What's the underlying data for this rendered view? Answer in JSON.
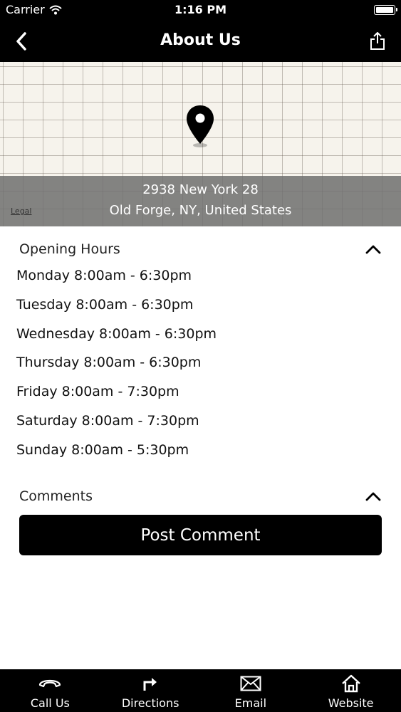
{
  "status_bar": {
    "carrier": "Carrier",
    "time": "1:16 PM"
  },
  "nav": {
    "title": "About Us",
    "back_icon": "chevron-left-icon",
    "share_icon": "share-icon"
  },
  "map": {
    "address_line1": "2938 New York 28",
    "address_line2": "Old Forge, NY, United States",
    "legal_label": "Legal",
    "pin_icon": "map-pin-icon"
  },
  "opening_hours": {
    "title": "Opening Hours",
    "toggle_icon": "chevron-up-icon",
    "days": [
      "Monday 8:00am - 6:30pm",
      "Tuesday 8:00am - 6:30pm",
      "Wednesday 8:00am - 6:30pm",
      "Thursday 8:00am - 6:30pm",
      "Friday 8:00am - 7:30pm",
      "Saturday 8:00am - 7:30pm",
      "Sunday 8:00am - 5:30pm"
    ]
  },
  "comments": {
    "title": "Comments",
    "toggle_icon": "chevron-up-icon",
    "post_button_label": "Post Comment"
  },
  "tab_bar": {
    "tabs": [
      {
        "label": "Call Us",
        "icon": "phone-icon"
      },
      {
        "label": "Directions",
        "icon": "directions-icon"
      },
      {
        "label": "Email",
        "icon": "email-icon"
      },
      {
        "label": "Website",
        "icon": "home-icon"
      }
    ]
  },
  "colors": {
    "bar_background": "#000000",
    "map_background": "#f6f3ec",
    "address_overlay": "#6e6e6e",
    "button_background": "#000000"
  }
}
